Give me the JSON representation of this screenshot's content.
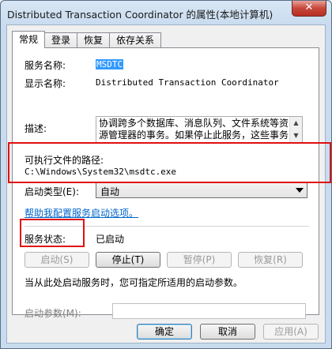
{
  "window": {
    "title": "Distributed Transaction Coordinator 的属性(本地计算机)",
    "close_glyph": "✕"
  },
  "tabs": [
    {
      "label": "常规",
      "active": true
    },
    {
      "label": "登录",
      "active": false
    },
    {
      "label": "恢复",
      "active": false
    },
    {
      "label": "依存关系",
      "active": false
    }
  ],
  "general": {
    "service_name_label": "服务名称:",
    "service_name_value": "MSDTC",
    "display_name_label": "显示名称:",
    "display_name_value": "Distributed Transaction Coordinator",
    "description_label": "描述:",
    "description_value": "协调跨多个数据库、消息队列、文件系统等资源管理器的事务。如果停止此服务，这些事务",
    "exe_path_label": "可执行文件的路径:",
    "exe_path_value": "C:\\Windows\\System32\\msdtc.exe",
    "startup_type_label": "启动类型(E):",
    "startup_type_value": "自动",
    "help_link": "帮助我配置服务启动选项。",
    "status_label": "服务状态:",
    "status_value": "已启动",
    "start_button": "启动(S)",
    "stop_button": "停止(T)",
    "pause_button": "暂停(P)",
    "resume_button": "恢复(R)",
    "hint_text": "当从此处启动服务时，您可指定所适用的启动参数。",
    "params_label": "启动参数(M):",
    "params_value": ""
  },
  "footer": {
    "ok_button": "确定",
    "cancel_button": "取消",
    "apply_button": "应用(A)"
  },
  "colors": {
    "highlight_annotation": "#e01010",
    "selection": "#3399ff",
    "link": "#0066cc"
  }
}
